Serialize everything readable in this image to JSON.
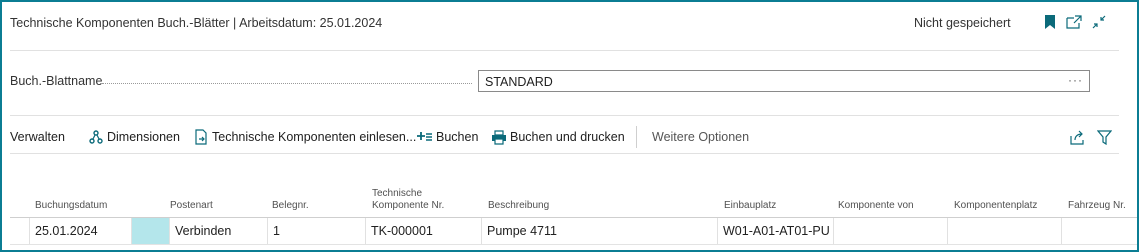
{
  "header": {
    "title": "Technische Komponenten Buch.-Blätter | Arbeitsdatum: 25.01.2024",
    "status": "Nicht gespeichert",
    "icons": [
      "bookmark-icon",
      "open-in-new-window-icon",
      "collapse-icon"
    ]
  },
  "journal": {
    "label": "Buch.-Blattname",
    "value": "STANDARD",
    "more": "···"
  },
  "actions": {
    "manage": "Verwalten",
    "dimensions": "Dimensionen",
    "import": "Technische Komponenten einlesen...",
    "post": "Buchen",
    "post_print": "Buchen und drucken",
    "more_options": "Weitere Optionen"
  },
  "table": {
    "columns": {
      "date": "Buchungsdatum",
      "entry_type": "Postenart",
      "doc_no": "Belegnr.",
      "component_no_line1": "Technische",
      "component_no_line2": "Komponente Nr.",
      "description": "Beschreibung",
      "location": "Einbauplatz",
      "component_of": "Komponente von",
      "component_location": "Komponentenplatz",
      "vehicle_no": "Fahrzeug Nr."
    },
    "rows": [
      {
        "date": "25.01.2024",
        "entry_type": "Verbinden",
        "doc_no": "1",
        "component_no": "TK-000001",
        "description": "Pumpe 4711",
        "location": "W01-A01-AT01-PU",
        "component_of": "",
        "component_location": "",
        "vehicle_no": ""
      }
    ]
  },
  "colors": {
    "frame_border": "#0b7d93",
    "accent": "#0b6a7a",
    "highlight_cell": "#b4e6eb"
  }
}
